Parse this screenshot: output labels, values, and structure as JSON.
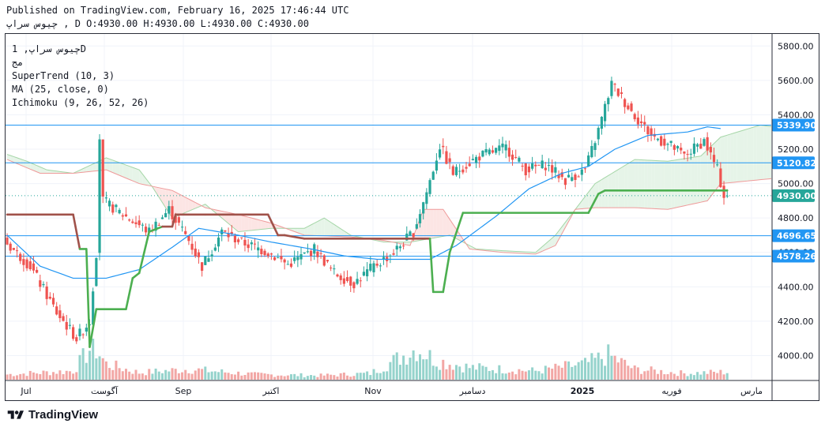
{
  "header": {
    "published": "Published on TradingView.com, February 16, 2025 17:46:44 UTC",
    "ohlc": "چیوس سراپ , D O:4930.00 H:4930.00 L:4930.00 C:4930.00"
  },
  "legend": {
    "symbol": "چیوس سراپ, 1D",
    "exchange": "مج",
    "indicators": [
      "SuperTrend (10, 3)",
      "MA (25, close, 0)",
      "Ichimoku (9, 26, 52, 26)"
    ]
  },
  "brand": {
    "name": "TradingView",
    "icon": "tradingview-logo-icon"
  },
  "colors": {
    "up": "#26a69a",
    "down": "#ef5350",
    "up_volume": "#95d3cc",
    "down_volume": "#f2a7a5",
    "supertrend_up": "#4caf50",
    "supertrend_down": "#a0524a",
    "ma": "#2196f3",
    "hline": "#2196f3",
    "kumo_green": "#e6f4e8",
    "kumo_red": "#fce5e4"
  },
  "chart_data": {
    "type": "candlestick",
    "title": "",
    "ylim": [
      3860,
      5870
    ],
    "y_ticks": [
      4000,
      4200,
      4400,
      4600,
      4800,
      5000,
      5200,
      5400,
      5600,
      5800
    ],
    "x_labels": [
      "Jul",
      "آگوست",
      "Sep",
      "اکتبر",
      "Nov",
      "دسامبر",
      "2025",
      "فوریه",
      "مارس"
    ],
    "price_lines": [
      {
        "label": "5339.90",
        "value": 5339.9
      },
      {
        "label": "5120.82",
        "value": 5120.82
      },
      {
        "label": "4930.00",
        "value": 4930.0,
        "last": true
      },
      {
        "label": "4696.65",
        "value": 4696.65
      },
      {
        "label": "4578.26",
        "value": 4578.26
      }
    ],
    "price_anchors": [
      [
        0,
        4670
      ],
      [
        8,
        4520
      ],
      [
        16,
        4250
      ],
      [
        22,
        4100
      ],
      [
        26,
        4200
      ],
      [
        28,
        4600
      ],
      [
        29,
        5270
      ],
      [
        30,
        4900
      ],
      [
        36,
        4820
      ],
      [
        44,
        4720
      ],
      [
        50,
        4850
      ],
      [
        56,
        4670
      ],
      [
        60,
        4520
      ],
      [
        66,
        4720
      ],
      [
        72,
        4660
      ],
      [
        80,
        4600
      ],
      [
        86,
        4530
      ],
      [
        94,
        4620
      ],
      [
        100,
        4480
      ],
      [
        106,
        4420
      ],
      [
        112,
        4520
      ],
      [
        118,
        4600
      ],
      [
        124,
        4720
      ],
      [
        128,
        4950
      ],
      [
        132,
        5220
      ],
      [
        136,
        5060
      ],
      [
        144,
        5160
      ],
      [
        152,
        5210
      ],
      [
        158,
        5080
      ],
      [
        164,
        5110
      ],
      [
        170,
        5020
      ],
      [
        176,
        5080
      ],
      [
        180,
        5310
      ],
      [
        184,
        5580
      ],
      [
        190,
        5420
      ],
      [
        196,
        5280
      ],
      [
        202,
        5220
      ],
      [
        206,
        5160
      ],
      [
        212,
        5250
      ],
      [
        216,
        5080
      ],
      [
        218,
        4930
      ]
    ],
    "volume_anchors": [
      [
        0,
        0.15
      ],
      [
        20,
        0.25
      ],
      [
        26,
        1.0
      ],
      [
        30,
        0.45
      ],
      [
        40,
        0.2
      ],
      [
        55,
        0.3
      ],
      [
        75,
        0.15
      ],
      [
        95,
        0.12
      ],
      [
        110,
        0.18
      ],
      [
        124,
        0.9
      ],
      [
        130,
        0.55
      ],
      [
        140,
        0.35
      ],
      [
        160,
        0.25
      ],
      [
        175,
        0.45
      ],
      [
        182,
        0.7
      ],
      [
        190,
        0.3
      ],
      [
        205,
        0.18
      ],
      [
        218,
        0.22
      ]
    ],
    "supertrend_anchors": [
      [
        0,
        4820
      ],
      [
        20,
        4820
      ],
      [
        22,
        4620
      ],
      [
        24,
        4620
      ],
      [
        25,
        4050
      ],
      [
        27,
        4270
      ],
      [
        36,
        4270
      ],
      [
        38,
        4450
      ],
      [
        40,
        4480
      ],
      [
        43,
        4720
      ],
      [
        47,
        4750
      ],
      [
        50,
        4750
      ],
      [
        51,
        4820
      ],
      [
        60,
        4820
      ],
      [
        79,
        4820
      ],
      [
        82,
        4700
      ],
      [
        84,
        4700
      ],
      [
        90,
        4680
      ],
      [
        128,
        4680
      ],
      [
        129,
        4370
      ],
      [
        132,
        4370
      ],
      [
        134,
        4600
      ],
      [
        138,
        4830
      ],
      [
        150,
        4830
      ],
      [
        176,
        4830
      ],
      [
        179,
        4940
      ],
      [
        181,
        4960
      ],
      [
        218,
        4960
      ]
    ],
    "ma_anchors": [
      [
        0,
        4700
      ],
      [
        10,
        4520
      ],
      [
        20,
        4450
      ],
      [
        30,
        4450
      ],
      [
        40,
        4500
      ],
      [
        50,
        4630
      ],
      [
        58,
        4740
      ],
      [
        70,
        4700
      ],
      [
        80,
        4660
      ],
      [
        92,
        4620
      ],
      [
        102,
        4580
      ],
      [
        112,
        4560
      ],
      [
        120,
        4560
      ],
      [
        128,
        4560
      ],
      [
        136,
        4640
      ],
      [
        148,
        4810
      ],
      [
        158,
        4970
      ],
      [
        168,
        5060
      ],
      [
        176,
        5100
      ],
      [
        184,
        5200
      ],
      [
        194,
        5280
      ],
      [
        206,
        5300
      ],
      [
        212,
        5330
      ],
      [
        216,
        5320
      ]
    ],
    "kumo_a_anchors": [
      [
        0,
        5170
      ],
      [
        6,
        5130
      ],
      [
        12,
        5080
      ],
      [
        20,
        5060
      ],
      [
        30,
        5150
      ],
      [
        40,
        5080
      ],
      [
        44,
        4980
      ],
      [
        50,
        4800
      ],
      [
        60,
        4880
      ],
      [
        70,
        4720
      ],
      [
        80,
        4740
      ],
      [
        90,
        4740
      ],
      [
        96,
        4800
      ],
      [
        104,
        4700
      ],
      [
        114,
        4660
      ],
      [
        122,
        4660
      ],
      [
        128,
        4680
      ],
      [
        134,
        4700
      ],
      [
        142,
        4620
      ],
      [
        150,
        4610
      ],
      [
        160,
        4600
      ],
      [
        166,
        4700
      ],
      [
        172,
        4850
      ],
      [
        178,
        5000
      ],
      [
        190,
        5140
      ],
      [
        200,
        5130
      ],
      [
        210,
        5160
      ],
      [
        216,
        5270
      ],
      [
        228,
        5340
      ],
      [
        232,
        5330
      ]
    ],
    "kumo_b_anchors": [
      [
        0,
        5140
      ],
      [
        10,
        5060
      ],
      [
        20,
        5060
      ],
      [
        30,
        5080
      ],
      [
        40,
        5000
      ],
      [
        50,
        4960
      ],
      [
        60,
        4860
      ],
      [
        70,
        4820
      ],
      [
        80,
        4770
      ],
      [
        90,
        4700
      ],
      [
        104,
        4690
      ],
      [
        114,
        4670
      ],
      [
        122,
        4640
      ],
      [
        126,
        4850
      ],
      [
        132,
        4850
      ],
      [
        140,
        4620
      ],
      [
        150,
        4600
      ],
      [
        160,
        4590
      ],
      [
        166,
        4640
      ],
      [
        172,
        4850
      ],
      [
        178,
        4860
      ],
      [
        190,
        4860
      ],
      [
        200,
        4850
      ],
      [
        212,
        4900
      ],
      [
        216,
        5000
      ],
      [
        232,
        5030
      ]
    ]
  }
}
